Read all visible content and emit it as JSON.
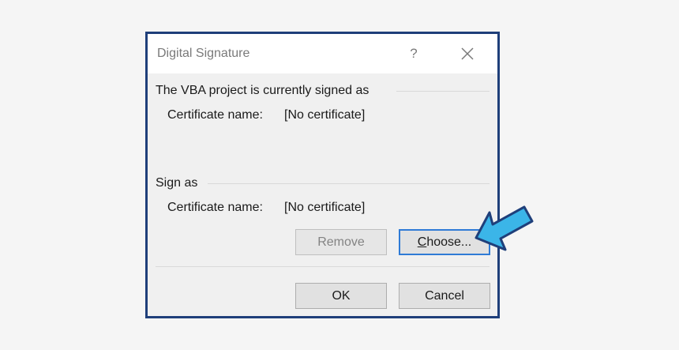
{
  "dialog": {
    "title": "Digital Signature",
    "help_glyph": "?",
    "close_icon": "close-icon"
  },
  "signed_section": {
    "heading": "The VBA project is currently signed as",
    "cert_key": "Certificate name:",
    "cert_value": "[No certificate]"
  },
  "sign_as_section": {
    "heading": "Sign as",
    "cert_key": "Certificate name:",
    "cert_value": "[No certificate]"
  },
  "buttons": {
    "remove_label": "Remove",
    "choose_first_letter": "C",
    "choose_rest": "hoose...",
    "ok_label": "OK",
    "cancel_label": "Cancel"
  },
  "annotation": {
    "arrow_icon": "pointer-arrow-icon",
    "arrow_fill": "#3bb5e8",
    "arrow_stroke": "#1f3f7a"
  },
  "colors": {
    "dialog_border": "#1f3f7a",
    "focus_border": "#2f7bd6"
  }
}
